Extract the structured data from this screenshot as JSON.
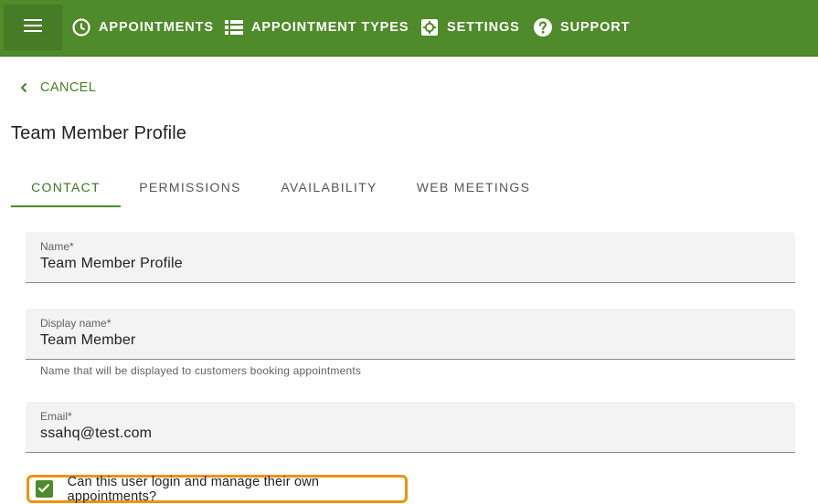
{
  "nav": {
    "menu_icon": "hamburger-icon",
    "items": [
      {
        "label": "APPOINTMENTS",
        "icon": "clock-icon"
      },
      {
        "label": "APPOINTMENT TYPES",
        "icon": "list-icon"
      },
      {
        "label": "SETTINGS",
        "icon": "gear-icon"
      },
      {
        "label": "SUPPORT",
        "icon": "help-icon"
      }
    ]
  },
  "cancel": {
    "label": "CANCEL",
    "icon": "chevron-left-icon"
  },
  "page": {
    "title": "Team Member Profile"
  },
  "tabs": [
    {
      "label": "CONTACT",
      "active": true
    },
    {
      "label": "PERMISSIONS",
      "active": false
    },
    {
      "label": "AVAILABILITY",
      "active": false
    },
    {
      "label": "WEB MEETINGS",
      "active": false
    }
  ],
  "form": {
    "name": {
      "label": "Name*",
      "value": "Team Member Profile"
    },
    "display_name": {
      "label": "Display name*",
      "value": "Team Member",
      "hint": "Name that will be displayed to customers booking appointments"
    },
    "email": {
      "label": "Email*",
      "value": "ssahq@test.com"
    },
    "login_checkbox": {
      "label": "Can this user login and manage their own appointments?",
      "checked": true
    }
  },
  "colors": {
    "brand": "#4f8a2b",
    "highlight": "#f0930f"
  }
}
